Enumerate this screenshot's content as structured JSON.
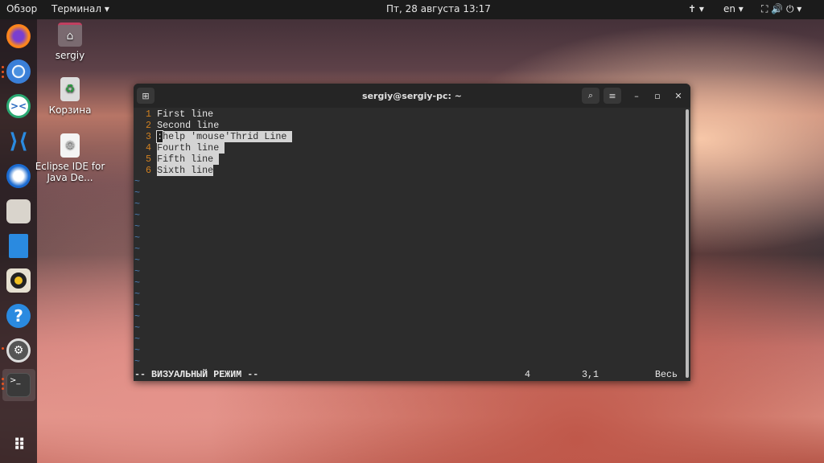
{
  "topbar": {
    "overview": "Обзор",
    "app": "Терминал ▾",
    "clock": "Пт, 28 августа  13:17",
    "accessibility": "✝ ▾",
    "lang": "en ▾",
    "system": "⛶ 🔊 ⏻ ▾"
  },
  "dock": {
    "items": [
      {
        "name": "firefox"
      },
      {
        "name": "chromium"
      },
      {
        "name": "remote-desktop"
      },
      {
        "name": "vscode"
      },
      {
        "name": "thunderbird"
      },
      {
        "name": "files"
      },
      {
        "name": "libreoffice-writer"
      },
      {
        "name": "rhythmbox"
      },
      {
        "name": "help"
      },
      {
        "name": "settings"
      },
      {
        "name": "terminal"
      },
      {
        "name": "show-apps"
      }
    ],
    "help_glyph": "?",
    "terminal_glyph": ">_"
  },
  "desktop": {
    "icons": [
      {
        "label": "sergiy"
      },
      {
        "label": "Корзина"
      },
      {
        "label": "Eclipse IDE for Java De..."
      }
    ]
  },
  "terminal": {
    "title": "sergiy@sergiy-pc: ~",
    "lines": [
      {
        "n": "1",
        "text": "First line"
      },
      {
        "n": "2",
        "text": "Second line"
      },
      {
        "n": "3",
        "cursor": ":",
        "text": "help 'mouse'Thrid Line "
      },
      {
        "n": "4",
        "text": "Fourth line "
      },
      {
        "n": "5",
        "text": "Fifth line "
      },
      {
        "n": "6",
        "text": "Sixth line"
      }
    ],
    "tilde": "~",
    "status": {
      "mode": "-- ВИЗУАЛЬНЫЙ РЕЖИМ --",
      "selected": "4",
      "position": "3,1",
      "scroll": "Весь"
    }
  }
}
